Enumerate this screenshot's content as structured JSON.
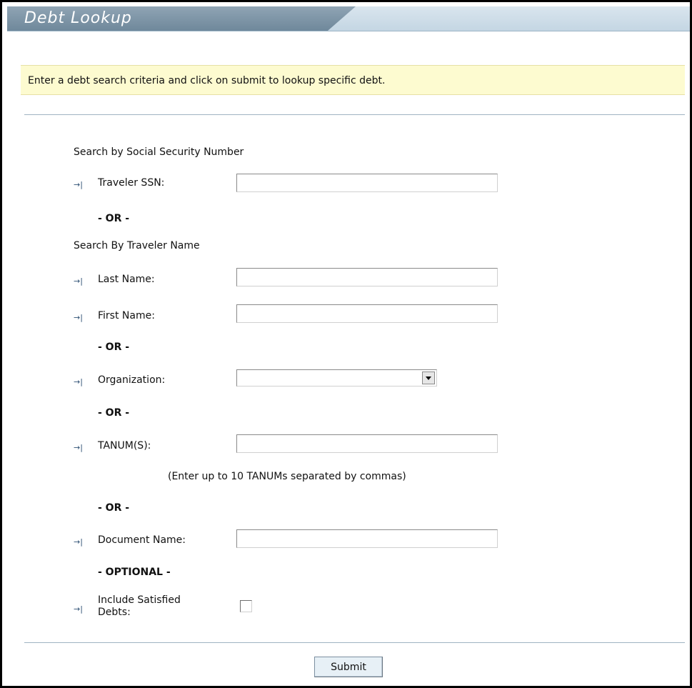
{
  "header": {
    "title": "Debt Lookup"
  },
  "info": {
    "message": "Enter a debt search criteria and click on submit to lookup specific debt."
  },
  "form": {
    "ssn_section": "Search by Social Security Number",
    "ssn_label": "Traveler SSN:",
    "ssn_value": "",
    "or_label": "- OR -",
    "name_section": "Search By Traveler Name",
    "last_name_label": "Last Name:",
    "last_name_value": "",
    "first_name_label": "First Name:",
    "first_name_value": "",
    "organization_label": "Organization:",
    "organization_value": "",
    "tanum_label": "TANUM(S):",
    "tanum_value": "",
    "tanum_hint": "(Enter up to 10 TANUMs separated by commas)",
    "document_label": "Document Name:",
    "document_value": "",
    "optional_label": "- OPTIONAL -",
    "satisfied_label_line1": "Include Satisfied",
    "satisfied_label_line2": "Debts:",
    "satisfied_checked": false,
    "submit_label": "Submit"
  },
  "icons": {
    "field_marker": "arrow-to-bar-icon"
  },
  "colors": {
    "title_tab": "#7f95a6",
    "banner": "#fdfbd0",
    "rule": "#9fb3c2",
    "submit_bg": "#e7f0f6"
  }
}
